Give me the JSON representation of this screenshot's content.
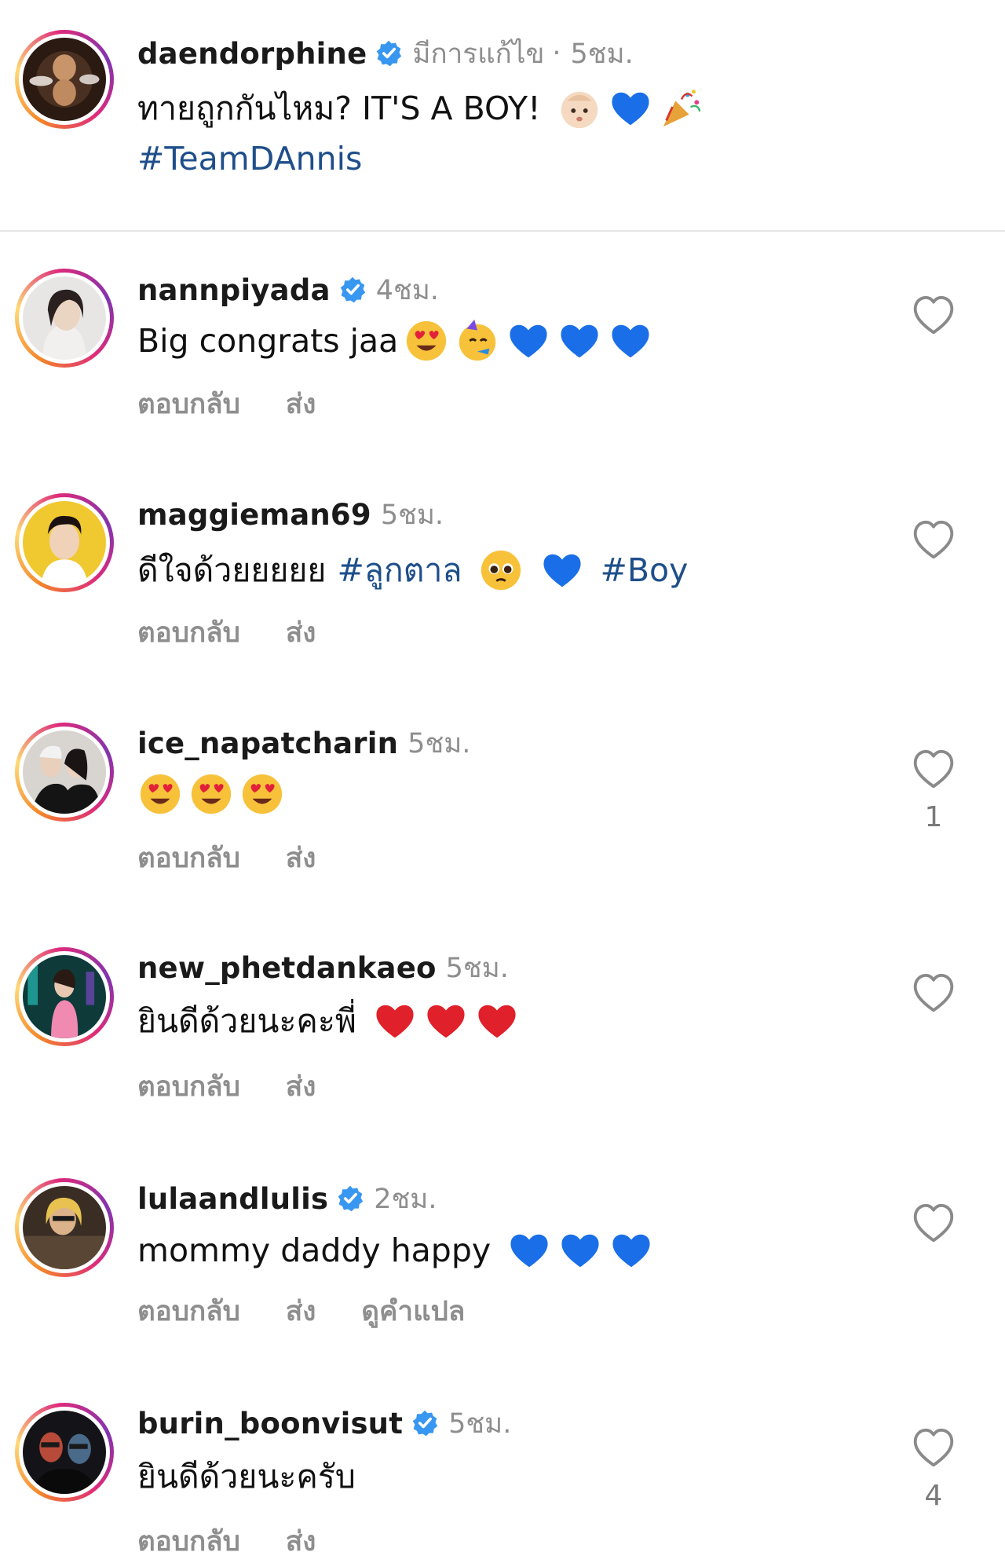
{
  "caption": {
    "username": "daendorphine",
    "edited": "มีการแก้ไข",
    "separator": "·",
    "time": "5ชม.",
    "text": "ทายถูกกันไหม? IT'S A BOY!",
    "hashtag": "#TeamDAnnis",
    "emojis": [
      "baby-emoji",
      "blue-heart-emoji",
      "party-popper-emoji"
    ]
  },
  "actions": {
    "reply": "ตอบกลับ",
    "send": "ส่ง",
    "translate": "ดูคำแปล"
  },
  "comments": [
    {
      "username": "nannpiyada",
      "verified": true,
      "time": "4ชม.",
      "text": "Big congrats jaa",
      "likes": ""
    },
    {
      "username": "maggieman69",
      "verified": false,
      "time": "5ชม.",
      "text": "ดีใจด้วยยยยย",
      "hashtag1": "#ลูกตาล",
      "hashtag2": "#Boy",
      "likes": ""
    },
    {
      "username": "ice_napatcharin",
      "verified": false,
      "time": "5ชม.",
      "text": "",
      "likes": "1"
    },
    {
      "username": "new_phetdankaeo",
      "verified": false,
      "time": "5ชม.",
      "text": "ยินดีด้วยนะคะพี่",
      "likes": ""
    },
    {
      "username": "lulaandlulis",
      "verified": true,
      "time": "2ชม.",
      "text": "mommy daddy happy",
      "likes": ""
    },
    {
      "username": "burin_boonvisut",
      "verified": true,
      "time": "5ชม.",
      "text": "ยินดีด้วยนะครับ",
      "likes": "4"
    }
  ],
  "colors": {
    "hashtag": "#1f4f8a",
    "muted": "#8e8e8e",
    "verified": "#3897f0",
    "blue_heart": "#1a6fe8",
    "red_heart": "#e0202a"
  }
}
